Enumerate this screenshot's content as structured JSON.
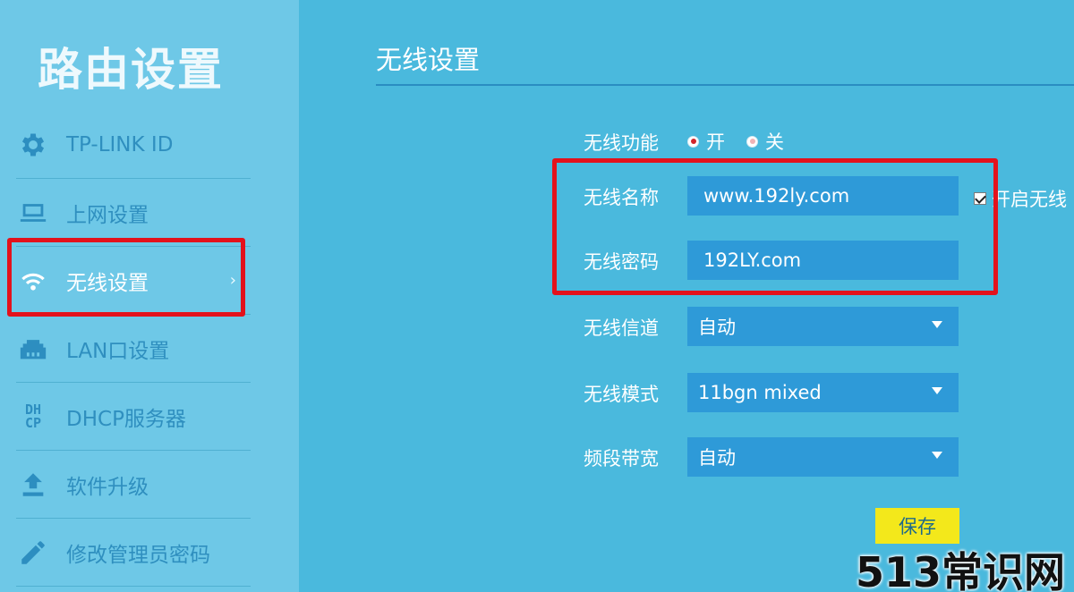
{
  "sidebar": {
    "brand": "路由设置",
    "items": [
      {
        "label": "TP-LINK ID",
        "icon": "gear-icon"
      },
      {
        "label": "上网设置",
        "icon": "laptop-icon"
      },
      {
        "label": "无线设置",
        "icon": "wifi-icon",
        "active": true,
        "chevron": "›"
      },
      {
        "label": "LAN口设置",
        "icon": "lan-port-icon"
      },
      {
        "label": "DHCP服务器",
        "icon": "dhcp-icon",
        "icon_text_top": "DH",
        "icon_text_bottom": "CP"
      },
      {
        "label": "软件升级",
        "icon": "upload-icon"
      },
      {
        "label": "修改管理员密码",
        "icon": "pencil-icon"
      }
    ]
  },
  "main": {
    "title": "无线设置",
    "wireless_function": {
      "label": "无线功能",
      "on_label": "开",
      "off_label": "关",
      "selected": "开"
    },
    "ssid": {
      "label": "无线名称",
      "value": "www.192ly.com",
      "checkbox_label": "开启无线"
    },
    "password": {
      "label": "无线密码",
      "value": "192LY.com"
    },
    "channel": {
      "label": "无线信道",
      "value": "自动"
    },
    "mode": {
      "label": "无线模式",
      "value": "11bgn mixed"
    },
    "bandwidth": {
      "label": "频段带宽",
      "value": "自动"
    },
    "save_label": "保存"
  },
  "watermark": "513常识网",
  "colors": {
    "sidebar_bg": "#6ec8e7",
    "main_bg": "#4ab9dd",
    "field_bg": "#2e9ad8",
    "highlight_red": "#e3121c",
    "save_yellow": "#f3e81b"
  }
}
